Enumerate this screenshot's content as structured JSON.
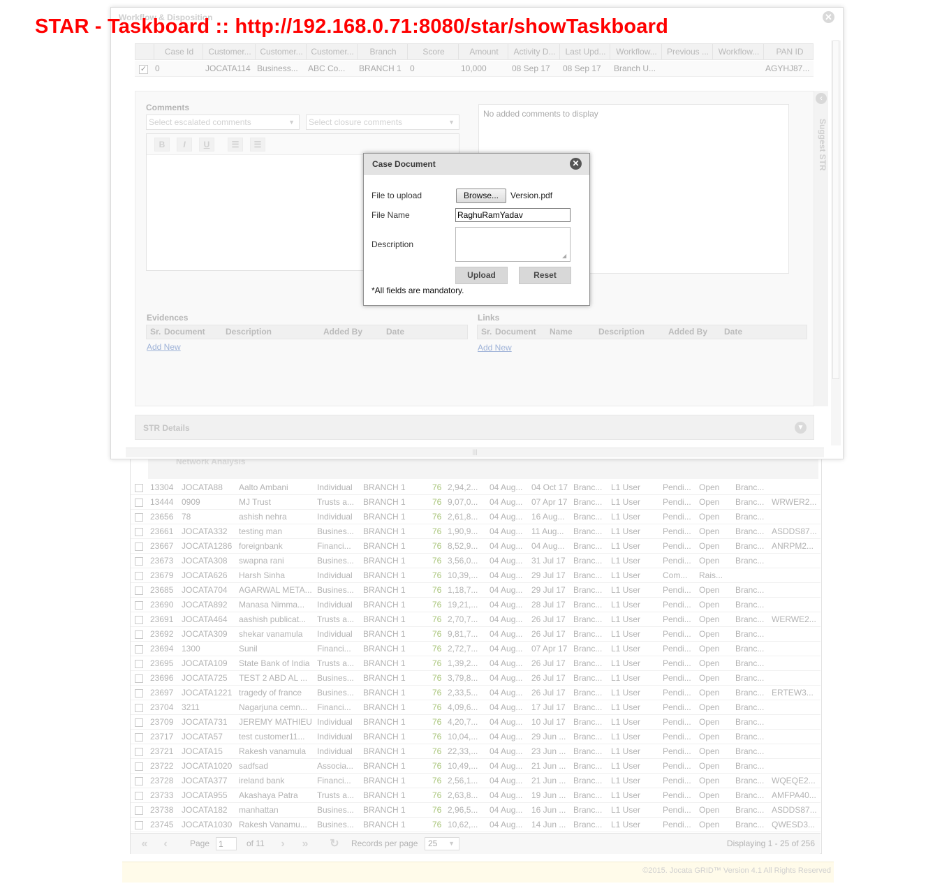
{
  "page_heading": "STAR - Taskboard :: http://192.168.0.71:8080/star/showTaskboard",
  "workflow_modal": {
    "title": "Workflow & Disposition",
    "close_glyph": "✕",
    "case_grid": {
      "columns": [
        "Case Id",
        "Customer...",
        "Customer...",
        "Customer...",
        "Branch",
        "Score",
        "Amount",
        "Activity D...",
        "Last Upd...",
        "Workflow...",
        "Previous ...",
        "Workflow...",
        "PAN ID"
      ],
      "row": [
        "0",
        "JOCATA114",
        "Business...",
        "ABC Co...",
        "BRANCH 1",
        "0",
        "10,000",
        "08 Sep 17",
        "08 Sep 17",
        "Branch U...",
        "",
        "",
        "AGYHJ87..."
      ],
      "row_checked": true
    },
    "comments": {
      "label": "Comments",
      "escalated_placeholder": "Select escalated comments",
      "closure_placeholder": "Select closure comments",
      "toolbar": [
        "B",
        "I",
        "U",
        "ordered-list-icon",
        "unordered-list-icon"
      ],
      "empty_text": "No added comments to display"
    },
    "suggest_str_label": "Suggest STR",
    "evidences": {
      "title": "Evidences",
      "columns": [
        "Sr.",
        "Document",
        "Description",
        "Added By",
        "Date"
      ],
      "add_new": "Add New"
    },
    "links": {
      "title": "Links",
      "columns": [
        "Sr.",
        "Document",
        "Name",
        "Description",
        "Added By",
        "Date"
      ],
      "add_new": "Add New"
    },
    "str_details": "STR Details"
  },
  "case_document_dialog": {
    "title": "Case Document",
    "file_to_upload_label": "File to upload",
    "browse_label": "Browse...",
    "chosen_file": "Version.pdf",
    "file_name_label": "File Name",
    "file_name_value": "RaghuRamYadav",
    "description_label": "Description",
    "description_value": "",
    "upload_label": "Upload",
    "reset_label": "Reset",
    "mandatory_note": "*All fields are mandatory."
  },
  "background_grid": {
    "section_title": "Network Analysis",
    "rows": [
      [
        "13304",
        "JOCATA88",
        "Aalto Ambani",
        "Individual",
        "BRANCH 1",
        "76",
        "2,94,2...",
        "04 Aug...",
        "04 Oct 17",
        "Branc...",
        "L1 User",
        "Pendi...",
        "Open",
        "Branc...",
        ""
      ],
      [
        "13444",
        "0909",
        "MJ Trust",
        "Trusts a...",
        "BRANCH 1",
        "76",
        "9,07,0...",
        "04 Aug...",
        "07 Apr 17",
        "Branc...",
        "L1 User",
        "Pendi...",
        "Open",
        "Branc...",
        "WRWER2..."
      ],
      [
        "23656",
        "78",
        "ashish nehra",
        "Individual",
        "BRANCH 1",
        "76",
        "2,61,8...",
        "04 Aug...",
        "16 Aug...",
        "Branc...",
        "L1 User",
        "Pendi...",
        "Open",
        "Branc...",
        ""
      ],
      [
        "23661",
        "JOCATA332",
        "testing man",
        "Busines...",
        "BRANCH 1",
        "76",
        "1,90,9...",
        "04 Aug...",
        "11 Aug...",
        "Branc...",
        "L1 User",
        "Pendi...",
        "Open",
        "Branc...",
        "ASDDS87..."
      ],
      [
        "23667",
        "JOCATA1286",
        "foreignbank",
        "Financi...",
        "BRANCH 1",
        "76",
        "8,52,9...",
        "04 Aug...",
        "04 Aug...",
        "Branc...",
        "L1 User",
        "Pendi...",
        "Open",
        "Branc...",
        "ANRPM2..."
      ],
      [
        "23673",
        "JOCATA308",
        "swapna rani",
        "Busines...",
        "BRANCH 1",
        "76",
        "3,56,0...",
        "04 Aug...",
        "31 Jul 17",
        "Branc...",
        "L1 User",
        "Pendi...",
        "Open",
        "Branc...",
        ""
      ],
      [
        "23679",
        "JOCATA626",
        "Harsh Sinha",
        "Individual",
        "BRANCH 1",
        "76",
        "10,39,...",
        "04 Aug...",
        "29 Jul 17",
        "Branc...",
        "L1 User",
        "Com...",
        "Rais...",
        "",
        ""
      ],
      [
        "23685",
        "JOCATA704",
        "AGARWAL META...",
        "Busines...",
        "BRANCH 1",
        "76",
        "1,18,7...",
        "04 Aug...",
        "29 Jul 17",
        "Branc...",
        "L1 User",
        "Pendi...",
        "Open",
        "Branc...",
        ""
      ],
      [
        "23690",
        "JOCATA892",
        "Manasa Nimma...",
        "Individual",
        "BRANCH 1",
        "76",
        "19,21,...",
        "04 Aug...",
        "28 Jul 17",
        "Branc...",
        "L1 User",
        "Pendi...",
        "Open",
        "Branc...",
        ""
      ],
      [
        "23691",
        "JOCATA464",
        "aashish publicat...",
        "Trusts a...",
        "BRANCH 1",
        "76",
        "2,70,7...",
        "04 Aug...",
        "26 Jul 17",
        "Branc...",
        "L1 User",
        "Pendi...",
        "Open",
        "Branc...",
        "WERWE2..."
      ],
      [
        "23692",
        "JOCATA309",
        "shekar vanamula",
        "Individual",
        "BRANCH 1",
        "76",
        "9,81,7...",
        "04 Aug...",
        "26 Jul 17",
        "Branc...",
        "L1 User",
        "Pendi...",
        "Open",
        "Branc...",
        ""
      ],
      [
        "23694",
        "1300",
        "Sunil",
        "Financi...",
        "BRANCH 1",
        "76",
        "2,72,7...",
        "04 Aug...",
        "07 Apr 17",
        "Branc...",
        "L1 User",
        "Pendi...",
        "Open",
        "Branc...",
        ""
      ],
      [
        "23695",
        "JOCATA109",
        "State Bank of India",
        "Trusts a...",
        "BRANCH 1",
        "76",
        "1,39,2...",
        "04 Aug...",
        "26 Jul 17",
        "Branc...",
        "L1 User",
        "Pendi...",
        "Open",
        "Branc...",
        ""
      ],
      [
        "23696",
        "JOCATA725",
        "TEST 2 ABD AL ...",
        "Busines...",
        "BRANCH 1",
        "76",
        "3,79,8...",
        "04 Aug...",
        "26 Jul 17",
        "Branc...",
        "L1 User",
        "Pendi...",
        "Open",
        "Branc...",
        ""
      ],
      [
        "23697",
        "JOCATA1221",
        "tragedy of france",
        "Busines...",
        "BRANCH 1",
        "76",
        "2,33,5...",
        "04 Aug...",
        "26 Jul 17",
        "Branc...",
        "L1 User",
        "Pendi...",
        "Open",
        "Branc...",
        "ERTEW3..."
      ],
      [
        "23704",
        "3211",
        "Nagarjuna cemn...",
        "Financi...",
        "BRANCH 1",
        "76",
        "4,09,6...",
        "04 Aug...",
        "17 Jul 17",
        "Branc...",
        "L1 User",
        "Pendi...",
        "Open",
        "Branc...",
        ""
      ],
      [
        "23709",
        "JOCATA731",
        "JEREMY MATHIEU",
        "Individual",
        "BRANCH 1",
        "76",
        "4,20,7...",
        "04 Aug...",
        "10 Jul 17",
        "Branc...",
        "L1 User",
        "Pendi...",
        "Open",
        "Branc...",
        ""
      ],
      [
        "23717",
        "JOCATA57",
        "test customer11...",
        "Individual",
        "BRANCH 1",
        "76",
        "10,04,...",
        "04 Aug...",
        "29 Jun ...",
        "Branc...",
        "L1 User",
        "Pendi...",
        "Open",
        "Branc...",
        ""
      ],
      [
        "23721",
        "JOCATA15",
        "Rakesh vanamula",
        "Individual",
        "BRANCH 1",
        "76",
        "22,33,...",
        "04 Aug...",
        "23 Jun ...",
        "Branc...",
        "L1 User",
        "Pendi...",
        "Open",
        "Branc...",
        ""
      ],
      [
        "23722",
        "JOCATA1020",
        "sadfsad",
        "Associa...",
        "BRANCH 1",
        "76",
        "10,49,...",
        "04 Aug...",
        "21 Jun ...",
        "Branc...",
        "L1 User",
        "Pendi...",
        "Open",
        "Branc...",
        ""
      ],
      [
        "23728",
        "JOCATA377",
        "ireland bank",
        "Financi...",
        "BRANCH 1",
        "76",
        "2,56,1...",
        "04 Aug...",
        "21 Jun ...",
        "Branc...",
        "L1 User",
        "Pendi...",
        "Open",
        "Branc...",
        "WQEQE2..."
      ],
      [
        "23733",
        "JOCATA955",
        "Akashaya Patra",
        "Trusts a...",
        "BRANCH 1",
        "76",
        "2,63,8...",
        "04 Aug...",
        "19 Jun ...",
        "Branc...",
        "L1 User",
        "Pendi...",
        "Open",
        "Branc...",
        "AMFPA40..."
      ],
      [
        "23738",
        "JOCATA182",
        "manhattan",
        "Busines...",
        "BRANCH 1",
        "76",
        "2,96,5...",
        "04 Aug...",
        "16 Jun ...",
        "Branc...",
        "L1 User",
        "Pendi...",
        "Open",
        "Branc...",
        "ASDDS87..."
      ],
      [
        "23745",
        "JOCATA1030",
        "Rakesh Vanamu...",
        "Busines...",
        "BRANCH 1",
        "76",
        "10,62,...",
        "04 Aug...",
        "14 Jun ...",
        "Branc...",
        "L1 User",
        "Pendi...",
        "Open",
        "Branc...",
        "QWESD3..."
      ]
    ],
    "pager": {
      "page_label": "Page",
      "page_value": "1",
      "of_label": "of 11",
      "records_label": "Records per page",
      "records_value": "25",
      "displaying": "Displaying 1 - 25 of 256"
    }
  },
  "footer": "©2015. Jocata GRID™ Version 4.1 All Rights Reserved"
}
